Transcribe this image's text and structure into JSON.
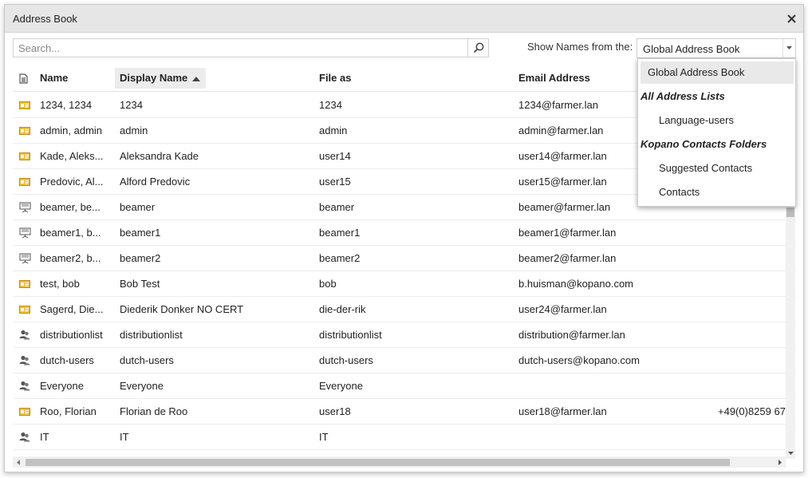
{
  "window": {
    "title": "Address Book"
  },
  "toolbar": {
    "search_placeholder": "Search...",
    "show_label": "Show Names from the:",
    "selected_source": "Global Address Book"
  },
  "columns": {
    "name": "Name",
    "display_name": "Display Name",
    "file_as": "File as",
    "email": "Email Address"
  },
  "rows": [
    {
      "icon": "contact-card-icon",
      "name": "1234, 1234",
      "display": "1234",
      "fileas": "1234",
      "email": "1234@farmer.lan",
      "phone": ""
    },
    {
      "icon": "contact-card-icon",
      "name": "admin, admin",
      "display": "admin",
      "fileas": "admin",
      "email": "admin@farmer.lan",
      "phone": ""
    },
    {
      "icon": "contact-card-icon",
      "name": "Kade, Aleks...",
      "display": "Aleksandra Kade",
      "fileas": "user14",
      "email": "user14@farmer.lan",
      "phone": ""
    },
    {
      "icon": "contact-card-icon",
      "name": "Predovic, Al...",
      "display": "Alford Predovic",
      "fileas": "user15",
      "email": "user15@farmer.lan",
      "phone": ""
    },
    {
      "icon": "projector-icon",
      "name": "beamer, be...",
      "display": "beamer",
      "fileas": "beamer",
      "email": "beamer@farmer.lan",
      "phone": ""
    },
    {
      "icon": "projector-icon",
      "name": "beamer1, b...",
      "display": "beamer1",
      "fileas": "beamer1",
      "email": "beamer1@farmer.lan",
      "phone": ""
    },
    {
      "icon": "projector-icon",
      "name": "beamer2, b...",
      "display": "beamer2",
      "fileas": "beamer2",
      "email": "beamer2@farmer.lan",
      "phone": ""
    },
    {
      "icon": "contact-card-icon",
      "name": "test, bob",
      "display": "Bob Test",
      "fileas": "bob",
      "email": "b.huisman@kopano.com",
      "phone": ""
    },
    {
      "icon": "contact-card-icon",
      "name": "Sagerd, Die...",
      "display": "Diederik Donker NO CERT",
      "fileas": "die-der-rik",
      "email": "user24@farmer.lan",
      "phone": ""
    },
    {
      "icon": "group-icon",
      "name": "distributionlist",
      "display": "distributionlist",
      "fileas": "distributionlist",
      "email": "distribution@farmer.lan",
      "phone": ""
    },
    {
      "icon": "group-icon",
      "name": "dutch-users",
      "display": "dutch-users",
      "fileas": "dutch-users",
      "email": "dutch-users@kopano.com",
      "phone": ""
    },
    {
      "icon": "group-icon",
      "name": "Everyone",
      "display": "Everyone",
      "fileas": "Everyone",
      "email": "",
      "phone": ""
    },
    {
      "icon": "contact-card-icon",
      "name": "Roo, Florian",
      "display": "Florian de Roo",
      "fileas": "user18",
      "email": "user18@farmer.lan",
      "phone": "+49(0)8259 67"
    },
    {
      "icon": "group-icon",
      "name": "IT",
      "display": "IT",
      "fileas": "IT",
      "email": "",
      "phone": ""
    }
  ],
  "dropdown": {
    "items": [
      {
        "label": "Global Address Book",
        "kind": "top",
        "selected": true
      },
      {
        "label": "All Address Lists",
        "kind": "group"
      },
      {
        "label": "Language-users",
        "kind": "indent"
      },
      {
        "label": "Kopano Contacts Folders",
        "kind": "group"
      },
      {
        "label": "Suggested Contacts",
        "kind": "indent"
      },
      {
        "label": "Contacts",
        "kind": "indent"
      }
    ]
  },
  "colors": {
    "card_icon": "#e9c13d",
    "titlebar": "#e6e6e6",
    "selected_item": "#e9e9e9"
  }
}
